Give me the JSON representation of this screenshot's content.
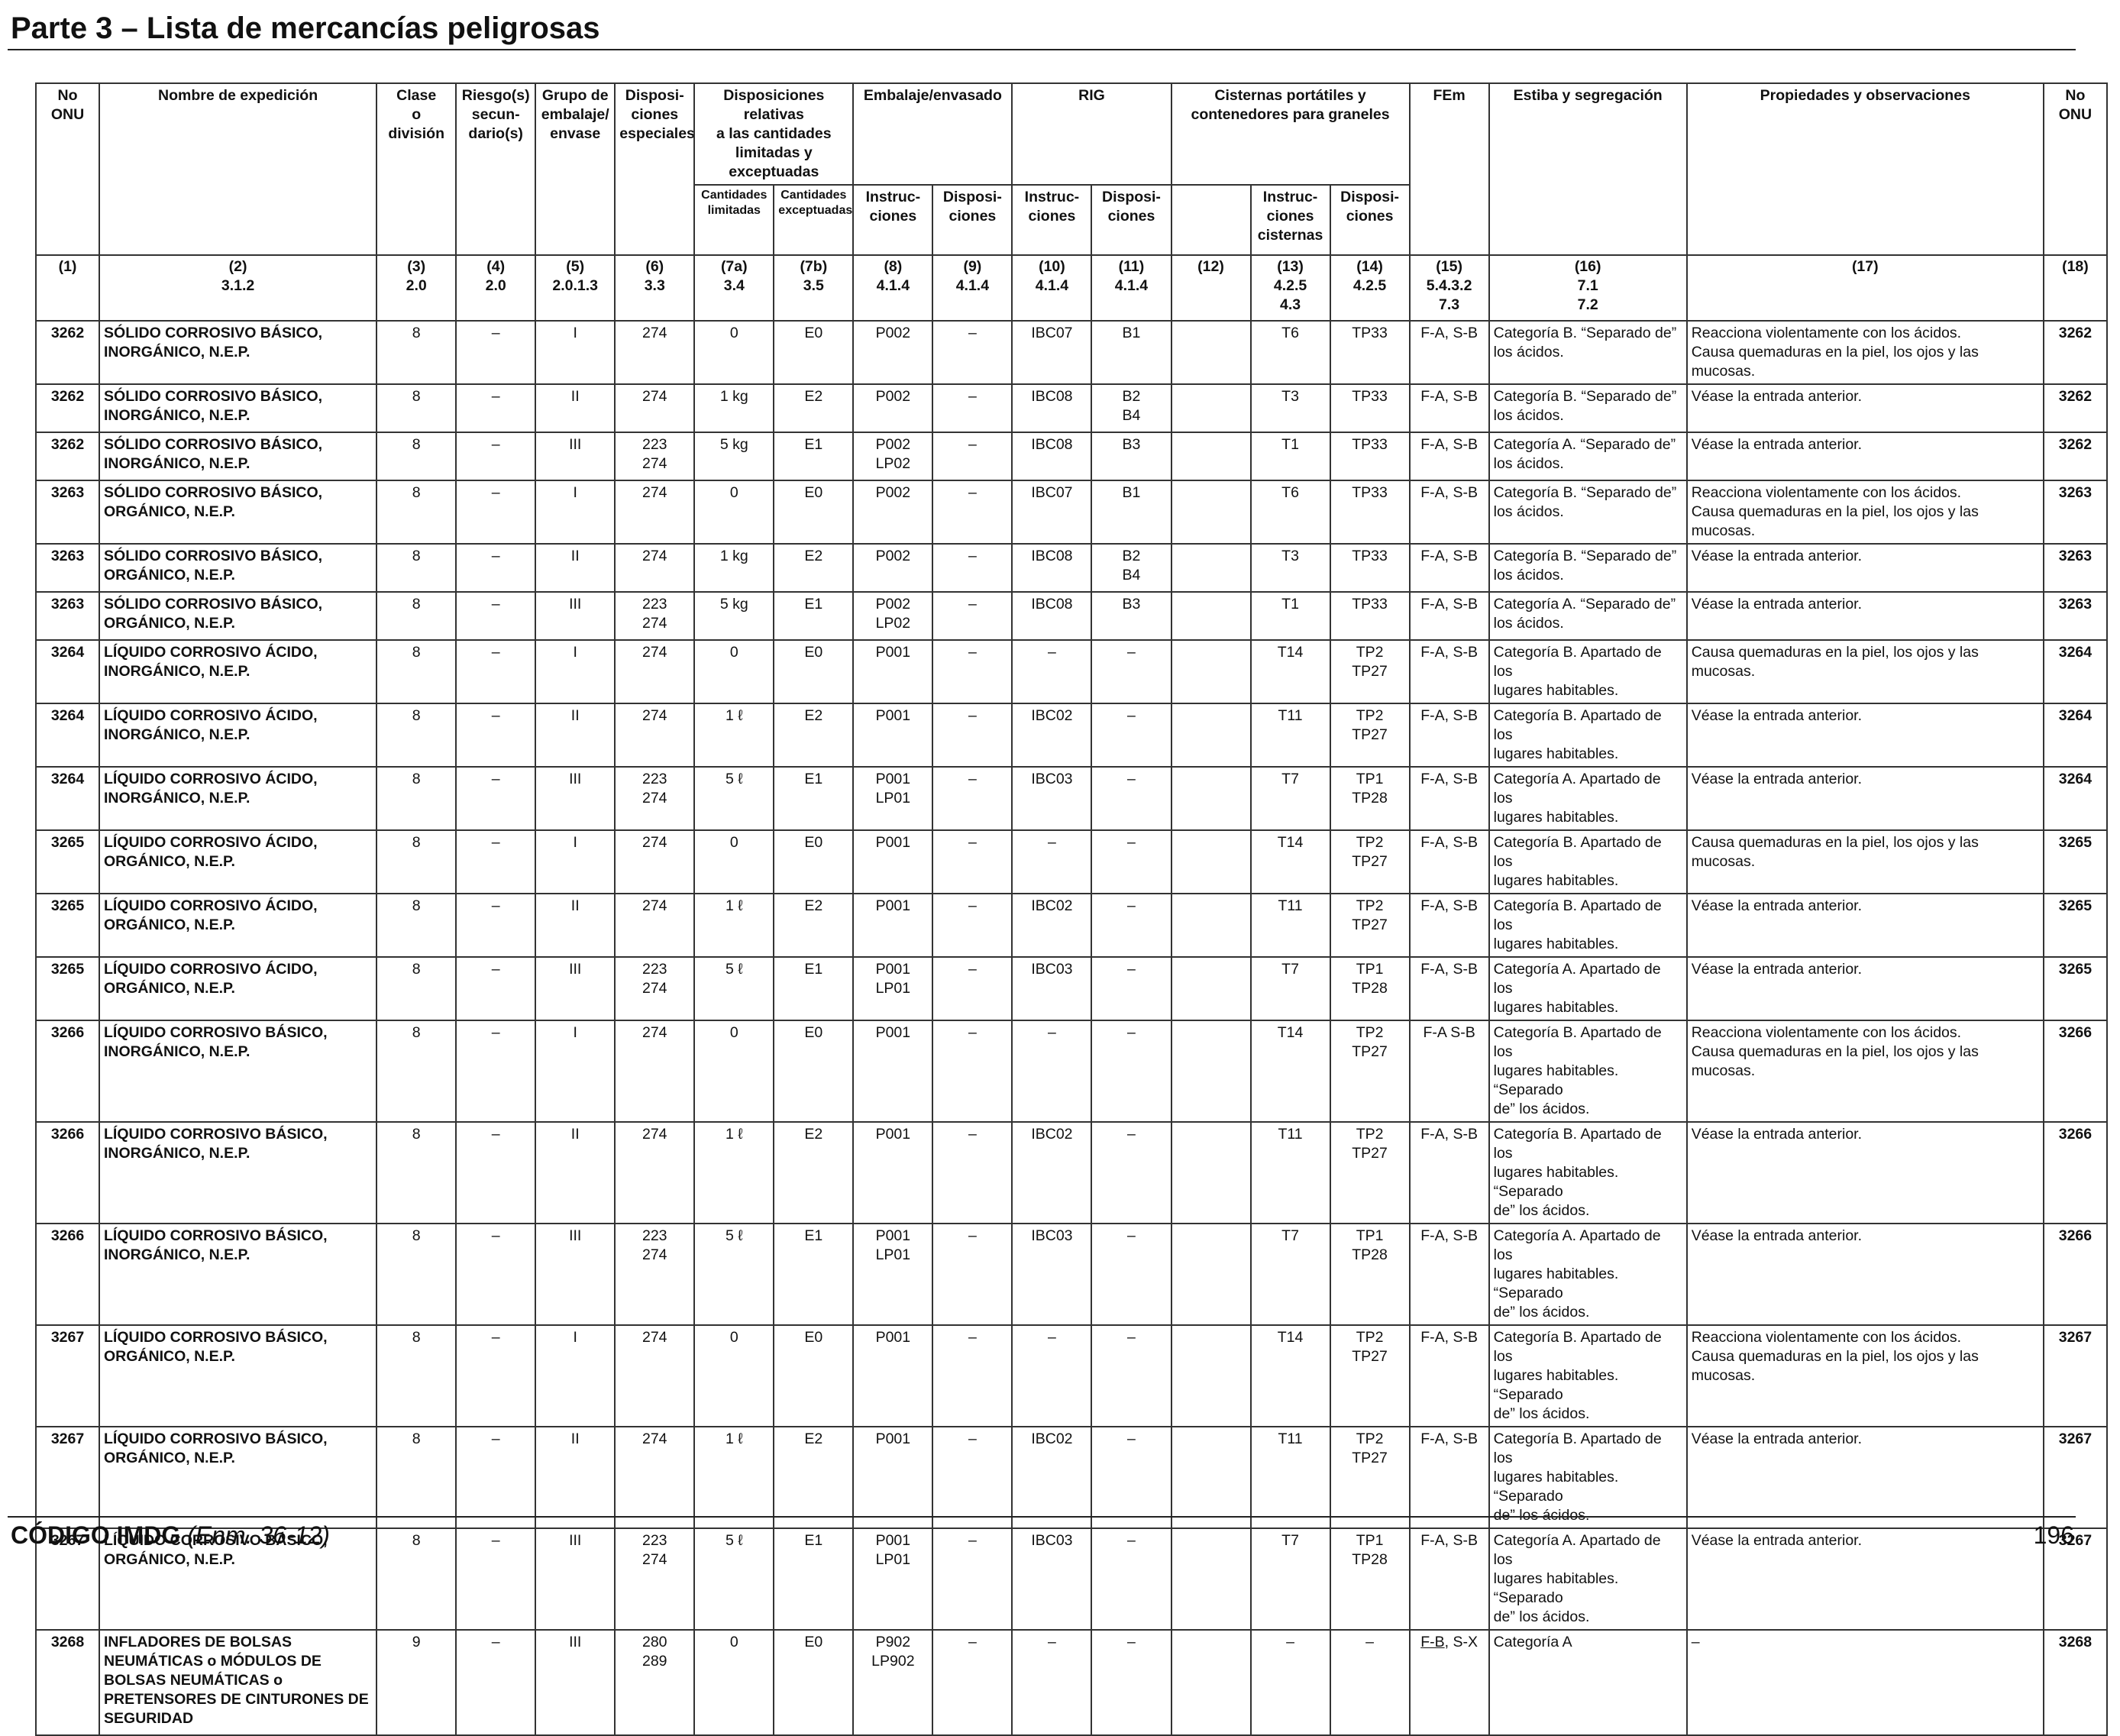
{
  "page": {
    "title": "Parte 3 – Lista de mercancías peligrosas",
    "footer": {
      "code": "CÓDIGO IMDG",
      "edition": "(Enm. 36-12)",
      "page_number": "196"
    }
  },
  "headers": {
    "no_onu": "No\nONU",
    "nombre": "Nombre de expedición",
    "clase": "Clase\no\ndivisión",
    "riesgo": "Riesgo(s)\nsecun-\ndario(s)",
    "grupo": "Grupo de\nembalaje/\nenvase",
    "disp_esp": "Disposi-\nciones\nespeciales",
    "disp_cant": "Disposiciones relativas\na las cantidades\nlimitadas y exceptuadas",
    "cant_lim": "Cantidades\nlimitadas",
    "cant_exc": "Cantidades\nexceptuadas",
    "embalaje": "Embalaje/envasado",
    "emb_instr": "Instruc-\nciones",
    "emb_disp": "Disposi-\nciones",
    "rig": "RIG",
    "rig_instr": "Instruc-\nciones",
    "rig_disp": "Disposi-\nciones",
    "cisternas": "Cisternas portátiles y\ncontenedores para graneles",
    "cist_instr": "Instruc-\nciones\ncisternas",
    "cist_disp": "Disposi-\nciones",
    "fem": "FEm",
    "estiba": "Estiba y segregación",
    "propiedades": "Propiedades y observaciones",
    "no_onu_right": "No\nONU"
  },
  "column_numbers": [
    "(1)",
    "(2)\n3.1.2",
    "(3)\n2.0",
    "(4)\n2.0",
    "(5)\n2.0.1.3",
    "(6)\n3.3",
    "(7a)\n3.4",
    "(7b)\n3.5",
    "(8)\n4.1.4",
    "(9)\n4.1.4",
    "(10)\n4.1.4",
    "(11)\n4.1.4",
    "(12)",
    "(13)\n4.2.5\n4.3",
    "(14)\n4.2.5",
    "(15)\n5.4.3.2\n7.3",
    "(16)\n7.1\n7.2",
    "(17)",
    "(18)"
  ],
  "rows": [
    [
      "3262",
      "SÓLIDO CORROSIVO BÁSICO,\nINORGÁNICO, N.E.P.",
      "8",
      "–",
      "I",
      "274",
      "0",
      "E0",
      "P002",
      "–",
      "IBC07",
      "B1",
      "",
      "T6",
      "TP33",
      "F-A, S-B",
      "Categoría B. “Separado de”\nlos ácidos.",
      "Reacciona violentamente con los ácidos.\nCausa quemaduras en la piel, los ojos y las mucosas.",
      "3262"
    ],
    [
      "3262",
      "SÓLIDO CORROSIVO BÁSICO,\nINORGÁNICO, N.E.P.",
      "8",
      "–",
      "II",
      "274",
      "1 kg",
      "E2",
      "P002",
      "–",
      "IBC08",
      "B2\nB4",
      "",
      "T3",
      "TP33",
      "F-A, S-B",
      "Categoría B. “Separado de”\nlos ácidos.",
      "Véase la entrada anterior.",
      "3262"
    ],
    [
      "3262",
      "SÓLIDO CORROSIVO BÁSICO,\nINORGÁNICO, N.E.P.",
      "8",
      "–",
      "III",
      "223\n274",
      "5 kg",
      "E1",
      "P002\nLP02",
      "–",
      "IBC08",
      "B3",
      "",
      "T1",
      "TP33",
      "F-A, S-B",
      "Categoría A. “Separado de”\nlos ácidos.",
      "Véase la entrada anterior.",
      "3262"
    ],
    [
      "3263",
      "SÓLIDO CORROSIVO BÁSICO,\nORGÁNICO, N.E.P.",
      "8",
      "–",
      "I",
      "274",
      "0",
      "E0",
      "P002",
      "–",
      "IBC07",
      "B1",
      "",
      "T6",
      "TP33",
      "F-A, S-B",
      "Categoría B. “Separado de”\nlos ácidos.",
      "Reacciona violentamente con los ácidos.\nCausa quemaduras en la piel, los ojos y las mucosas.",
      "3263"
    ],
    [
      "3263",
      "SÓLIDO CORROSIVO BÁSICO,\nORGÁNICO, N.E.P.",
      "8",
      "–",
      "II",
      "274",
      "1 kg",
      "E2",
      "P002",
      "–",
      "IBC08",
      "B2\nB4",
      "",
      "T3",
      "TP33",
      "F-A, S-B",
      "Categoría B. “Separado de”\nlos ácidos.",
      "Véase la entrada anterior.",
      "3263"
    ],
    [
      "3263",
      "SÓLIDO CORROSIVO BÁSICO,\nORGÁNICO, N.E.P.",
      "8",
      "–",
      "III",
      "223\n274",
      "5 kg",
      "E1",
      "P002\nLP02",
      "–",
      "IBC08",
      "B3",
      "",
      "T1",
      "TP33",
      "F-A, S-B",
      "Categoría A. “Separado de”\nlos ácidos.",
      "Véase la entrada anterior.",
      "3263"
    ],
    [
      "3264",
      "LÍQUIDO CORROSIVO ÁCIDO,\nINORGÁNICO, N.E.P.",
      "8",
      "–",
      "I",
      "274",
      "0",
      "E0",
      "P001",
      "–",
      "–",
      "–",
      "",
      "T14",
      "TP2\nTP27",
      "F-A, S-B",
      "Categoría B. Apartado de los\nlugares habitables.",
      "Causa quemaduras en la piel, los ojos y las mucosas.",
      "3264"
    ],
    [
      "3264",
      "LÍQUIDO CORROSIVO ÁCIDO,\nINORGÁNICO, N.E.P.",
      "8",
      "–",
      "II",
      "274",
      "1 ℓ",
      "E2",
      "P001",
      "–",
      "IBC02",
      "–",
      "",
      "T11",
      "TP2\nTP27",
      "F-A, S-B",
      "Categoría B. Apartado de los\nlugares habitables.",
      "Véase la entrada anterior.",
      "3264"
    ],
    [
      "3264",
      "LÍQUIDO CORROSIVO ÁCIDO,\nINORGÁNICO, N.E.P.",
      "8",
      "–",
      "III",
      "223\n274",
      "5 ℓ",
      "E1",
      "P001\nLP01",
      "–",
      "IBC03",
      "–",
      "",
      "T7",
      "TP1\nTP28",
      "F-A, S-B",
      "Categoría A. Apartado de los\nlugares habitables.",
      "Véase la entrada anterior.",
      "3264"
    ],
    [
      "3265",
      "LÍQUIDO CORROSIVO ÁCIDO,\nORGÁNICO, N.E.P.",
      "8",
      "–",
      "I",
      "274",
      "0",
      "E0",
      "P001",
      "–",
      "–",
      "–",
      "",
      "T14",
      "TP2\nTP27",
      "F-A, S-B",
      "Categoría B. Apartado de los\nlugares habitables.",
      "Causa quemaduras en la piel, los ojos y las mucosas.",
      "3265"
    ],
    [
      "3265",
      "LÍQUIDO CORROSIVO ÁCIDO,\nORGÁNICO, N.E.P.",
      "8",
      "–",
      "II",
      "274",
      "1 ℓ",
      "E2",
      "P001",
      "–",
      "IBC02",
      "–",
      "",
      "T11",
      "TP2\nTP27",
      "F-A, S-B",
      "Categoría B. Apartado de los\nlugares habitables.",
      "Véase la entrada anterior.",
      "3265"
    ],
    [
      "3265",
      "LÍQUIDO CORROSIVO ÁCIDO,\nORGÁNICO, N.E.P.",
      "8",
      "–",
      "III",
      "223\n274",
      "5 ℓ",
      "E1",
      "P001\nLP01",
      "–",
      "IBC03",
      "–",
      "",
      "T7",
      "TP1\nTP28",
      "F-A, S-B",
      "Categoría A. Apartado de los\nlugares habitables.",
      "Véase la entrada anterior.",
      "3265"
    ],
    [
      "3266",
      "LÍQUIDO CORROSIVO BÁSICO,\nINORGÁNICO, N.E.P.",
      "8",
      "–",
      "I",
      "274",
      "0",
      "E0",
      "P001",
      "–",
      "–",
      "–",
      "",
      "T14",
      "TP2\nTP27",
      "F-A S-B",
      "Categoría B. Apartado de los\nlugares habitables. “Separado\nde” los ácidos.",
      "Reacciona violentamente con los ácidos.\nCausa quemaduras en la piel, los ojos y las mucosas.",
      "3266"
    ],
    [
      "3266",
      "LÍQUIDO CORROSIVO BÁSICO,\nINORGÁNICO, N.E.P.",
      "8",
      "–",
      "II",
      "274",
      "1 ℓ",
      "E2",
      "P001",
      "–",
      "IBC02",
      "–",
      "",
      "T11",
      "TP2\nTP27",
      "F-A, S-B",
      "Categoría B. Apartado de los\nlugares habitables. “Separado\nde” los ácidos.",
      "Véase la entrada anterior.",
      "3266"
    ],
    [
      "3266",
      "LÍQUIDO CORROSIVO BÁSICO,\nINORGÁNICO, N.E.P.",
      "8",
      "–",
      "III",
      "223\n274",
      "5 ℓ",
      "E1",
      "P001\nLP01",
      "–",
      "IBC03",
      "–",
      "",
      "T7",
      "TP1\nTP28",
      "F-A, S-B",
      "Categoría A. Apartado de los\nlugares habitables. “Separado\nde” los ácidos.",
      "Véase la entrada anterior.",
      "3266"
    ],
    [
      "3267",
      "LÍQUIDO CORROSIVO BÁSICO,\nORGÁNICO, N.E.P.",
      "8",
      "–",
      "I",
      "274",
      "0",
      "E0",
      "P001",
      "–",
      "–",
      "–",
      "",
      "T14",
      "TP2\nTP27",
      "F-A, S-B",
      "Categoría B. Apartado de los\nlugares habitables. “Separado\nde” los ácidos.",
      "Reacciona violentamente con los ácidos.\nCausa quemaduras en la piel, los ojos y las mucosas.",
      "3267"
    ],
    [
      "3267",
      "LÍQUIDO CORROSIVO BÁSICO,\nORGÁNICO, N.E.P.",
      "8",
      "–",
      "II",
      "274",
      "1 ℓ",
      "E2",
      "P001",
      "–",
      "IBC02",
      "–",
      "",
      "T11",
      "TP2\nTP27",
      "F-A, S-B",
      "Categoría B. Apartado de los\nlugares habitables. “Separado\nde” los ácidos.",
      "Véase la entrada anterior.",
      "3267"
    ],
    [
      "3267",
      "LÍQUIDO CORROSIVO BÁSICO,\nORGÁNICO, N.E.P.",
      "8",
      "–",
      "III",
      "223\n274",
      "5 ℓ",
      "E1",
      "P001\nLP01",
      "–",
      "IBC03",
      "–",
      "",
      "T7",
      "TP1\nTP28",
      "F-A, S-B",
      "Categoría A. Apartado de los\nlugares habitables. “Separado\nde” los ácidos.",
      "Véase la entrada anterior.",
      "3267"
    ],
    [
      "3268",
      "INFLADORES DE BOLSAS\nNEUMÁTICAS o MÓDULOS DE\nBOLSAS NEUMÁTICAS o\nPRETENSORES DE CINTURONES DE\nSEGURIDAD",
      "9",
      "–",
      "III",
      "280\n289",
      "0",
      "E0",
      "P902\nLP902",
      "–",
      "–",
      "–",
      "",
      "–",
      "–",
      "F-B, S-X",
      "Categoría A",
      "–",
      "3268"
    ]
  ]
}
